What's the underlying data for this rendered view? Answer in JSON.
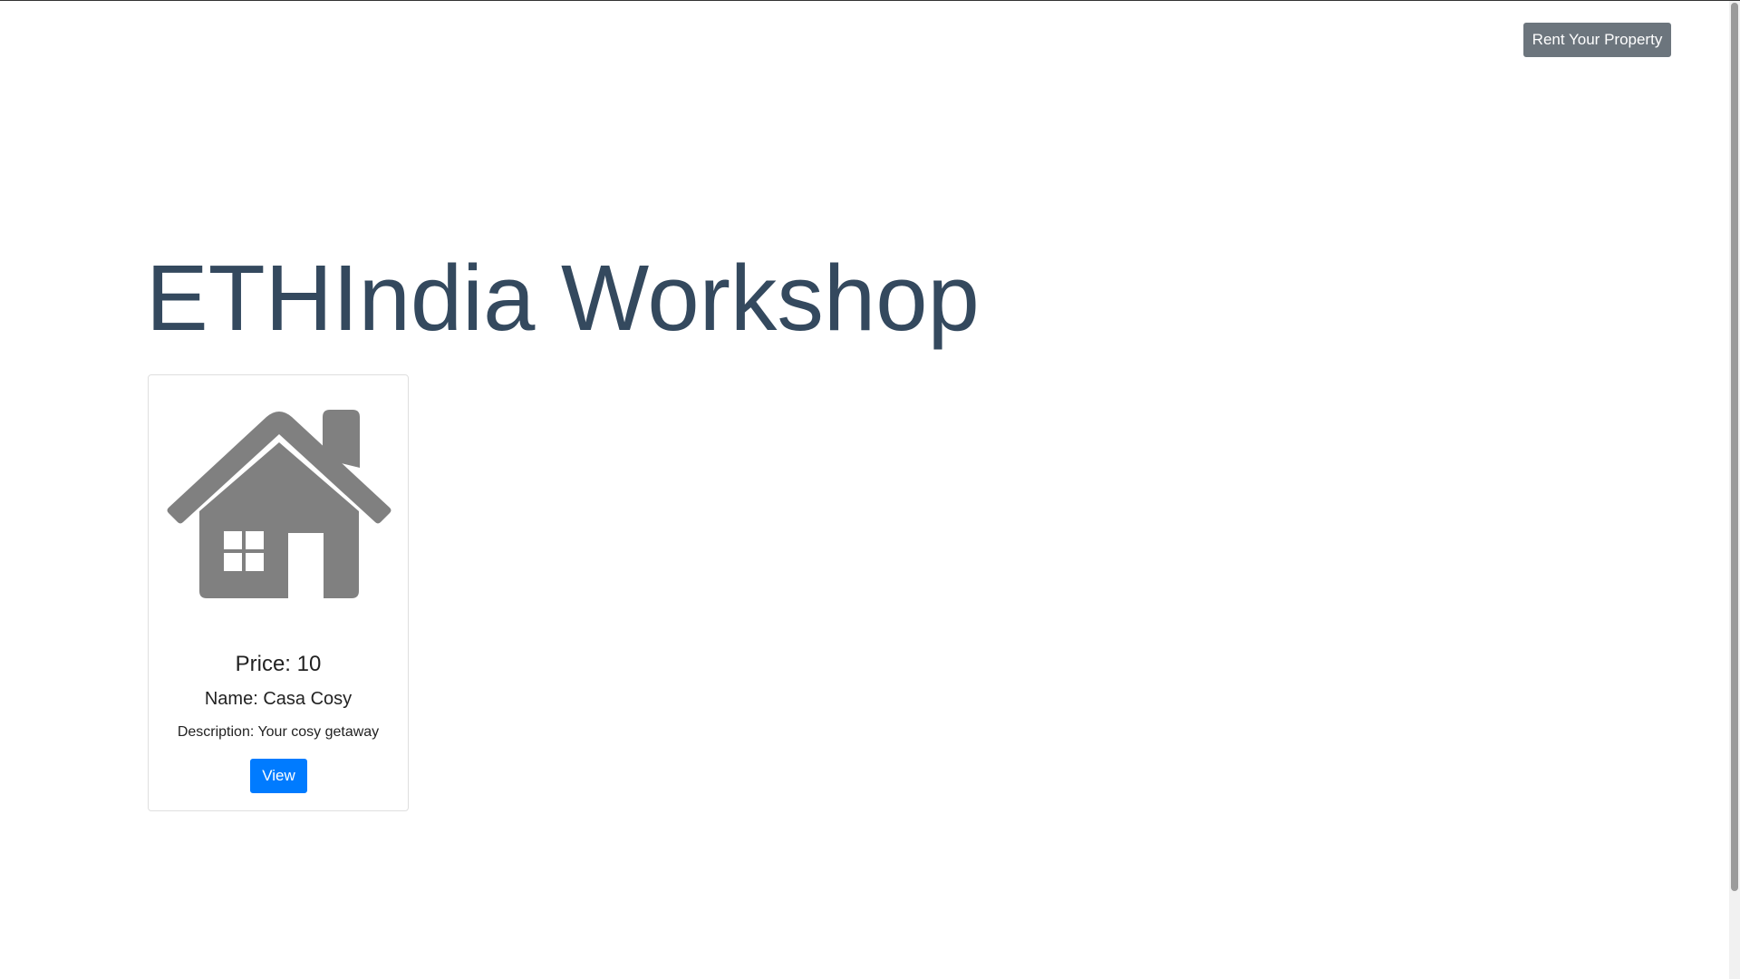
{
  "header": {
    "rent_button_label": "Rent Your Property"
  },
  "main": {
    "title": "ETHIndia Workshop"
  },
  "listing": {
    "icon": "house-icon",
    "icon_color": "#808080",
    "price_label": "Price:",
    "price_value": "10",
    "name_label": "Name:",
    "name_value": "Casa Cosy",
    "description_label": "Description:",
    "description_value": "Your cosy getaway",
    "view_button_label": "View"
  },
  "colors": {
    "title": "#34495e",
    "primary_button": "#007bff",
    "secondary_button": "#6c757d"
  }
}
